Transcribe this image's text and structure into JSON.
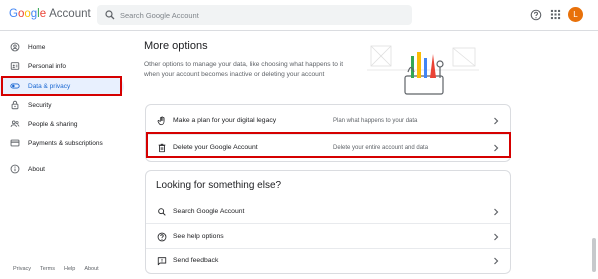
{
  "header": {
    "logo_letters": [
      "G",
      "o",
      "o",
      "g",
      "l",
      "e"
    ],
    "logo_suffix": "Account",
    "search_placeholder": "Search Google Account",
    "avatar_letter": "L",
    "icons": {
      "search": "search-icon",
      "help": "help-icon",
      "apps": "apps-grid-icon"
    }
  },
  "sidebar": {
    "items": [
      {
        "label": "Home",
        "icon": "home-icon"
      },
      {
        "label": "Personal info",
        "icon": "person-icon"
      },
      {
        "label": "Data & privacy",
        "icon": "toggle-icon",
        "active": true
      },
      {
        "label": "Security",
        "icon": "lock-icon"
      },
      {
        "label": "People & sharing",
        "icon": "people-icon"
      },
      {
        "label": "Payments & subscriptions",
        "icon": "credit-card-icon"
      },
      {
        "label": "About",
        "icon": "info-icon"
      }
    ],
    "footer": [
      "Privacy",
      "Terms",
      "Help",
      "About"
    ]
  },
  "main": {
    "title": "More options",
    "description": "Other options to manage your data, like choosing what happens to it when your account becomes inactive or deleting your account",
    "options": [
      {
        "label": "Make a plan for your digital legacy",
        "desc": "Plan what happens to your data",
        "icon": "hand-icon"
      },
      {
        "label": "Delete your Google Account",
        "desc": "Delete your entire account and data",
        "icon": "trash-icon"
      }
    ],
    "more": {
      "title": "Looking for something else?",
      "items": [
        {
          "label": "Search Google Account",
          "icon": "search-icon"
        },
        {
          "label": "See help options",
          "icon": "help-icon"
        },
        {
          "label": "Send feedback",
          "icon": "feedback-icon"
        }
      ]
    }
  },
  "colors": {
    "accent": "#1a73e8",
    "highlight": "#d50000",
    "active_bg": "#e8f0fe",
    "avatar": "#e8710a"
  }
}
